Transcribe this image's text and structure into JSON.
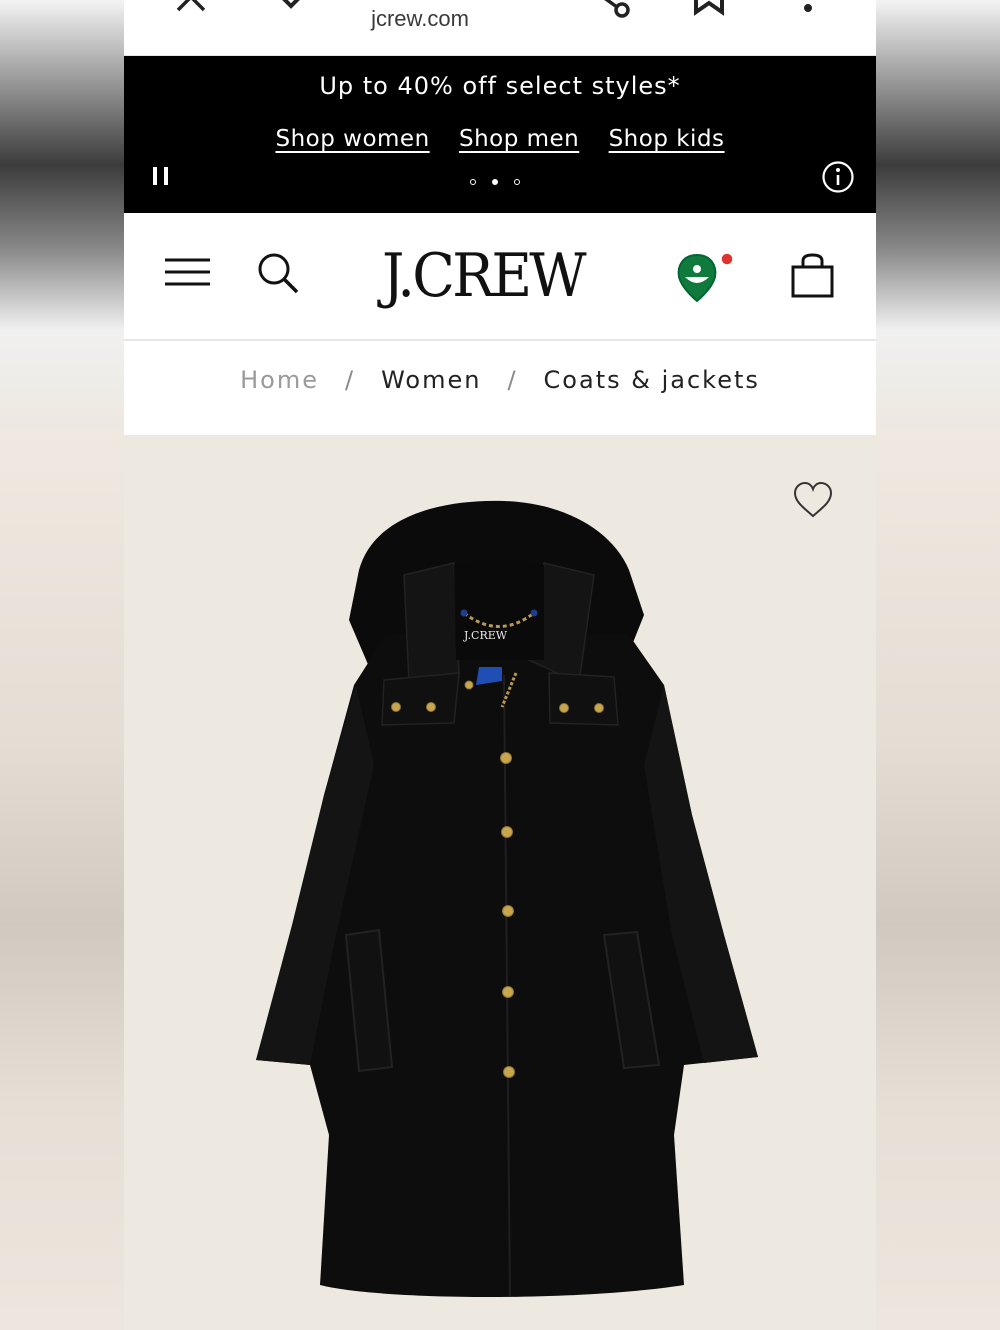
{
  "browser": {
    "url": "jcrew.com"
  },
  "promo": {
    "headline": "Up to 40% off select styles*",
    "links": [
      {
        "label": "Shop women"
      },
      {
        "label": "Shop men"
      },
      {
        "label": "Shop kids"
      }
    ],
    "carousel_active_index": 1,
    "carousel_count": 3
  },
  "header": {
    "logo": "J.CREW",
    "icons": [
      "menu-icon",
      "search-icon",
      "location-pin-icon",
      "shopping-bag-icon"
    ],
    "notification_color": "#e0322e",
    "pin_color": "#0f7a3b"
  },
  "breadcrumb": {
    "items": [
      "Home",
      "Women",
      "Coats & jackets"
    ],
    "separator": "/"
  },
  "product": {
    "image_alt": "black hooded wool coat with gold buttons",
    "background_color": "#ede8e0",
    "coat_label": "J.CREW"
  }
}
